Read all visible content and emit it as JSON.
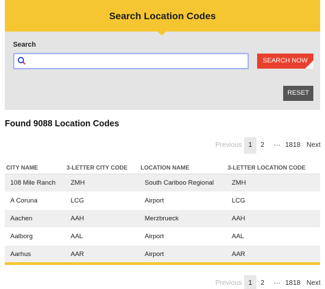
{
  "header": {
    "title": "Search Location Codes"
  },
  "search": {
    "label": "Search",
    "value": "",
    "placeholder": "",
    "submit_label": "SEARCH NOW",
    "reset_label": "RESET"
  },
  "results": {
    "title": "Found 9088 Location Codes"
  },
  "pagination": {
    "prev": "Previous",
    "pages": [
      "1",
      "2"
    ],
    "ellipsis": "···",
    "last": "1818",
    "next": "Next",
    "current": "1"
  },
  "table": {
    "headers": [
      "CITY NAME",
      "3-LETTER CITY CODE",
      "LOCATION NAME",
      "3-LETTER LOCATION CODE"
    ],
    "rows": [
      [
        "108 Mile Ranch",
        "ZMH",
        "South Cariboo Regional",
        "ZMH"
      ],
      [
        "A Coruna",
        "LCG",
        "Airport",
        "LCG"
      ],
      [
        "Aachen",
        "AAH",
        "Merzbrueck",
        "AAH"
      ],
      [
        "Aalborg",
        "AAL",
        "Airport",
        "AAL"
      ],
      [
        "Aarhus",
        "AAR",
        "Airport",
        "AAR"
      ]
    ]
  },
  "colors": {
    "accent": "#f6c632",
    "button": "#e8402e",
    "reset": "#555555",
    "panel": "#e4e4e4"
  }
}
